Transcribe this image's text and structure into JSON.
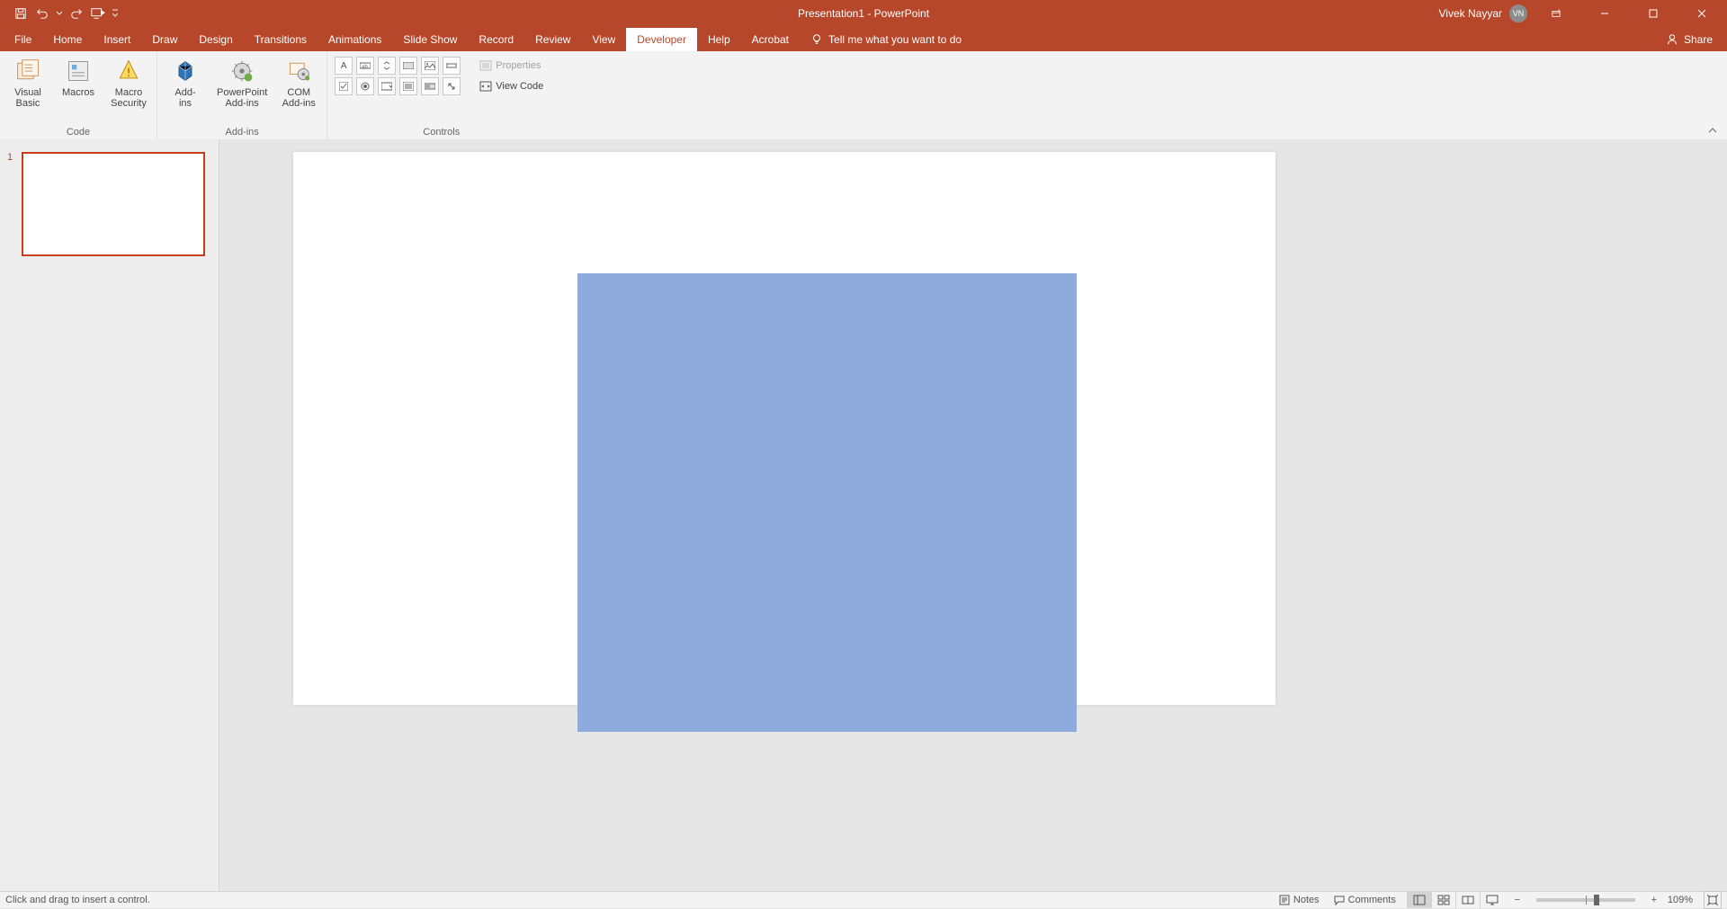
{
  "titlebar": {
    "doc_title": "Presentation1  -  PowerPoint",
    "user_name": "Vivek Nayyar",
    "user_initials": "VN"
  },
  "tabs": {
    "file": "File",
    "home": "Home",
    "insert": "Insert",
    "draw": "Draw",
    "design": "Design",
    "transitions": "Transitions",
    "animations": "Animations",
    "slideshow": "Slide Show",
    "record": "Record",
    "review": "Review",
    "view": "View",
    "developer": "Developer",
    "help": "Help",
    "acrobat": "Acrobat",
    "tellme": "Tell me what you want to do",
    "share": "Share"
  },
  "ribbon": {
    "code": {
      "visual_basic": "Visual\nBasic",
      "macros": "Macros",
      "macro_security": "Macro\nSecurity",
      "group": "Code"
    },
    "addins": {
      "addins": "Add-\nins",
      "pp_addins": "PowerPoint\nAdd-ins",
      "com_addins": "COM\nAdd-ins",
      "group": "Add-ins"
    },
    "controls": {
      "properties": "Properties",
      "view_code": "View Code",
      "group": "Controls"
    }
  },
  "slidepanel": {
    "slide1_num": "1"
  },
  "statusbar": {
    "left": "Click and drag to insert a control.",
    "notes": "Notes",
    "comments": "Comments",
    "zoom": "109%"
  }
}
